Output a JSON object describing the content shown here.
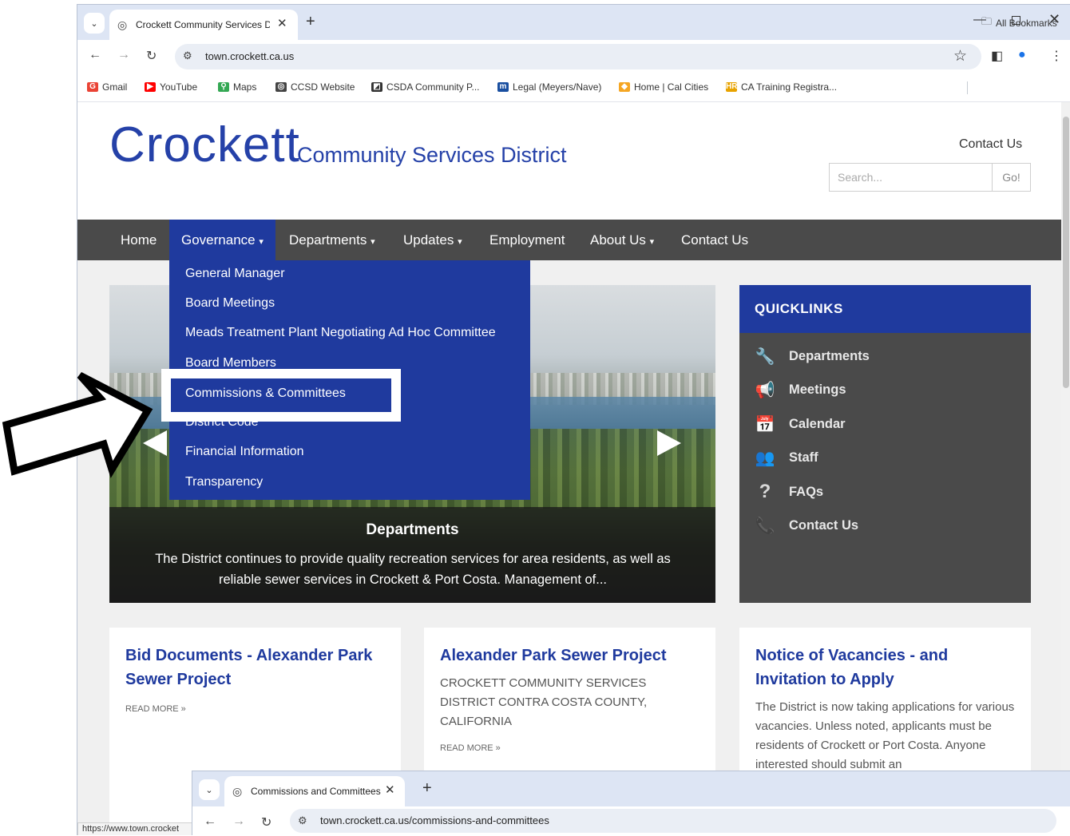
{
  "browser": {
    "tab_title": "Crockett Community Services D",
    "url": "town.crockett.ca.us",
    "bookmarks": [
      {
        "label": "Gmail",
        "icon": "gmail-icon",
        "color": "#ea4335"
      },
      {
        "label": "YouTube",
        "icon": "youtube-icon",
        "color": "#ff0000"
      },
      {
        "label": "Maps",
        "icon": "maps-icon",
        "color": "#34a853"
      },
      {
        "label": "CCSD Website",
        "icon": "globe-icon",
        "color": "#444444"
      },
      {
        "label": "CSDA Community P...",
        "icon": "csda-icon",
        "color": "#333333"
      },
      {
        "label": "Legal (Meyers/Nave)",
        "icon": "legal-icon",
        "color": "#1a4fa0"
      },
      {
        "label": "Home | Cal Cities",
        "icon": "calcities-icon",
        "color": "#f5a623"
      },
      {
        "label": "CA Training Registra...",
        "icon": "hr-icon",
        "color": "#e8a300"
      }
    ],
    "all_bookmarks": "All Bookmarks",
    "status_url": "https://www.town.crocket"
  },
  "site": {
    "logo_big": "Crockett",
    "logo_small": "Community Services District",
    "contact_link": "Contact Us",
    "search_placeholder": "Search...",
    "search_button": "Go!",
    "nav": [
      "Home",
      "Governance",
      "Departments",
      "Updates",
      "Employment",
      "About Us",
      "Contact Us"
    ],
    "dropdown": [
      "General Manager",
      "Board Meetings",
      "Meads Treatment Plant Negotiating Ad Hoc Committee",
      "Board Members",
      "Commissions & Committees",
      "District Code",
      "Financial Information",
      "Transparency"
    ],
    "hero": {
      "title": "Departments",
      "text": "The District continues to provide quality recreation services for area residents, as well as reliable sewer services in Crockett & Port Costa. Management of..."
    },
    "quicklinks": {
      "title": "QUICKLINKS",
      "items": [
        {
          "label": "Departments",
          "icon": "wrench-icon"
        },
        {
          "label": "Meetings",
          "icon": "megaphone-icon"
        },
        {
          "label": "Calendar",
          "icon": "calendar-icon"
        },
        {
          "label": "Staff",
          "icon": "people-icon"
        },
        {
          "label": "FAQs",
          "icon": "question-icon"
        },
        {
          "label": "Contact Us",
          "icon": "phone-icon"
        }
      ]
    },
    "cards": [
      {
        "title": "Bid Documents - Alexander Park Sewer Project",
        "body": "",
        "more": "READ MORE »"
      },
      {
        "title": "Alexander Park Sewer Project",
        "body": "CROCKETT COMMUNITY SERVICES DISTRICT CONTRA COSTA COUNTY, CALIFORNIA",
        "more": "READ MORE »"
      },
      {
        "title": "Notice of Vacancies - and Invitation to Apply",
        "body": "The District is now taking applications for various vacancies. Unless noted, applicants must be residents of Crockett or Port Costa. Anyone interested should submit an",
        "more": ""
      }
    ]
  },
  "browser2": {
    "tab_title": "Commissions and Committees",
    "url": "town.crockett.ca.us/commissions-and-committees"
  },
  "colors": {
    "brand_blue": "#1f3a9e",
    "nav_gray": "#4a4a4a",
    "highlight": "#ffffff"
  }
}
